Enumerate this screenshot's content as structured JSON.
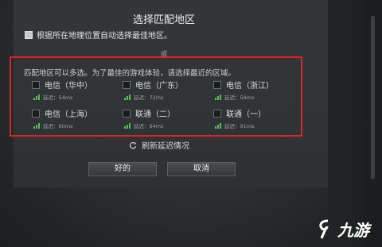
{
  "dialog": {
    "title": "选择匹配地区",
    "auto_label": "根据所在地理位置自动选择最佳地区。",
    "or_text": "或",
    "hint": "匹配地区可以多选。为了最佳的游戏体验，请选择最近的区域。",
    "regions": [
      {
        "name": "电信（华中）",
        "latency": "延迟：54ms"
      },
      {
        "name": "电信（广东）",
        "latency": "延迟：72ms"
      },
      {
        "name": "电信（浙江）",
        "latency": "延迟：59ms"
      },
      {
        "name": "电信（上海）",
        "latency": "延迟：60ms"
      },
      {
        "name": "联通（二）",
        "latency": "延迟：64ms"
      },
      {
        "name": "联通（一）",
        "latency": "延迟：91ms"
      }
    ],
    "refresh_label": "刷新延迟情况",
    "ok_label": "好的",
    "cancel_label": "取消"
  },
  "watermark": {
    "text": "九游"
  },
  "colors": {
    "highlight_border": "#d6252b",
    "signal": "#4ec34e"
  }
}
